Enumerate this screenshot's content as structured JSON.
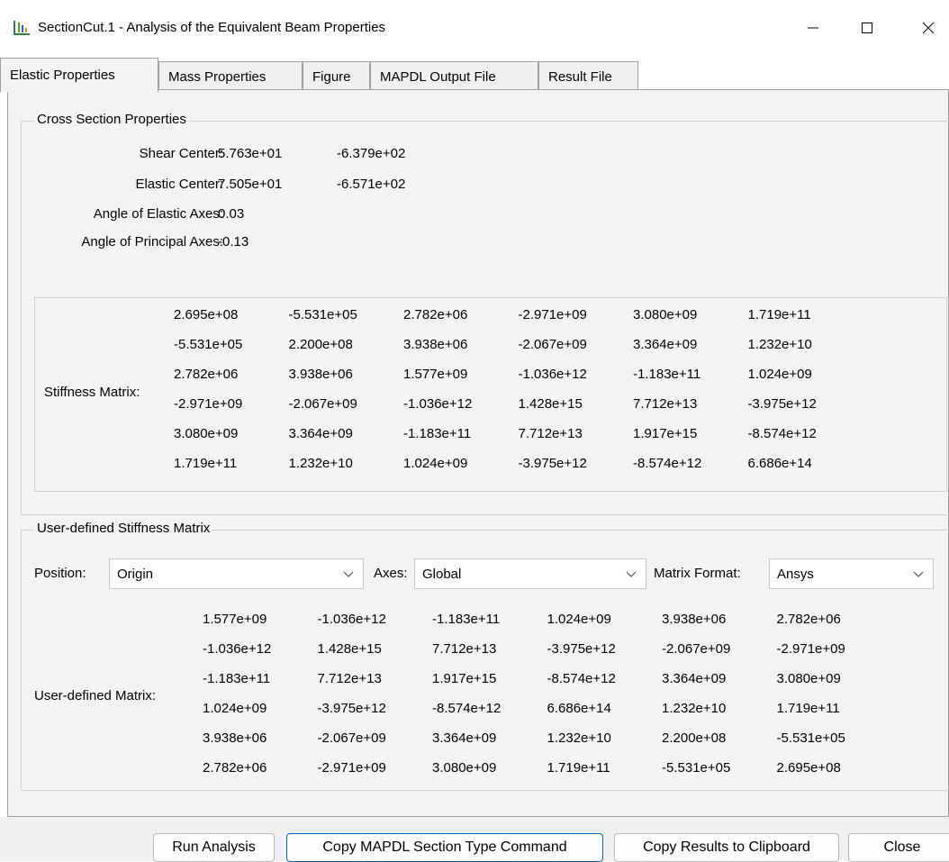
{
  "window": {
    "title": "SectionCut.1 - Analysis of the Equivalent Beam Properties"
  },
  "tabs": [
    {
      "label": "Elastic Properties",
      "active": true
    },
    {
      "label": "Mass Properties"
    },
    {
      "label": "Figure"
    },
    {
      "label": "MAPDL Output File"
    },
    {
      "label": "Result File"
    }
  ],
  "cross_section": {
    "title": "Cross Section Properties",
    "shear_center_label": "Shear Center:",
    "shear_center": [
      "5.763e+01",
      "-6.379e+02"
    ],
    "elastic_center_label": "Elastic Center:",
    "elastic_center": [
      "7.505e+01",
      "-6.571e+02"
    ],
    "angle_elastic_label": "Angle of Elastic Axes:",
    "angle_elastic": "0.03",
    "angle_principal_label": "Angle of Principal Axes:",
    "angle_principal": "-0.13",
    "stiffness_label": "Stiffness Matrix:",
    "stiffness": [
      [
        "2.695e+08",
        "-5.531e+05",
        "2.782e+06",
        "-2.971e+09",
        "3.080e+09",
        "1.719e+11"
      ],
      [
        "-5.531e+05",
        "2.200e+08",
        "3.938e+06",
        "-2.067e+09",
        "3.364e+09",
        "1.232e+10"
      ],
      [
        "2.782e+06",
        "3.938e+06",
        "1.577e+09",
        "-1.036e+12",
        "-1.183e+11",
        "1.024e+09"
      ],
      [
        "-2.971e+09",
        "-2.067e+09",
        "-1.036e+12",
        "1.428e+15",
        "7.712e+13",
        "-3.975e+12"
      ],
      [
        "3.080e+09",
        "3.364e+09",
        "-1.183e+11",
        "7.712e+13",
        "1.917e+15",
        "-8.574e+12"
      ],
      [
        "1.719e+11",
        "1.232e+10",
        "1.024e+09",
        "-3.975e+12",
        "-8.574e+12",
        "6.686e+14"
      ]
    ]
  },
  "user_defined": {
    "title": "User-defined Stiffness Matrix",
    "position_label": "Position:",
    "position_value": "Origin",
    "axes_label": "Axes:",
    "axes_value": "Global",
    "format_label": "Matrix Format:",
    "format_value": "Ansys",
    "matrix_label": "User-defined Matrix:",
    "matrix": [
      [
        "1.577e+09",
        "-1.036e+12",
        "-1.183e+11",
        "1.024e+09",
        "3.938e+06",
        "2.782e+06"
      ],
      [
        "-1.036e+12",
        "1.428e+15",
        "7.712e+13",
        "-3.975e+12",
        "-2.067e+09",
        "-2.971e+09"
      ],
      [
        "-1.183e+11",
        "7.712e+13",
        "1.917e+15",
        "-8.574e+12",
        "3.364e+09",
        "3.080e+09"
      ],
      [
        "1.024e+09",
        "-3.975e+12",
        "-8.574e+12",
        "6.686e+14",
        "1.232e+10",
        "1.719e+11"
      ],
      [
        "3.938e+06",
        "-2.067e+09",
        "3.364e+09",
        "1.232e+10",
        "2.200e+08",
        "-5.531e+05"
      ],
      [
        "2.782e+06",
        "-2.971e+09",
        "3.080e+09",
        "1.719e+11",
        "-5.531e+05",
        "2.695e+08"
      ]
    ]
  },
  "buttons": {
    "run": "Run Analysis",
    "copy_mapdl": "Copy MAPDL Section Type Command",
    "copy_results": "Copy Results to Clipboard",
    "close": "Close"
  }
}
